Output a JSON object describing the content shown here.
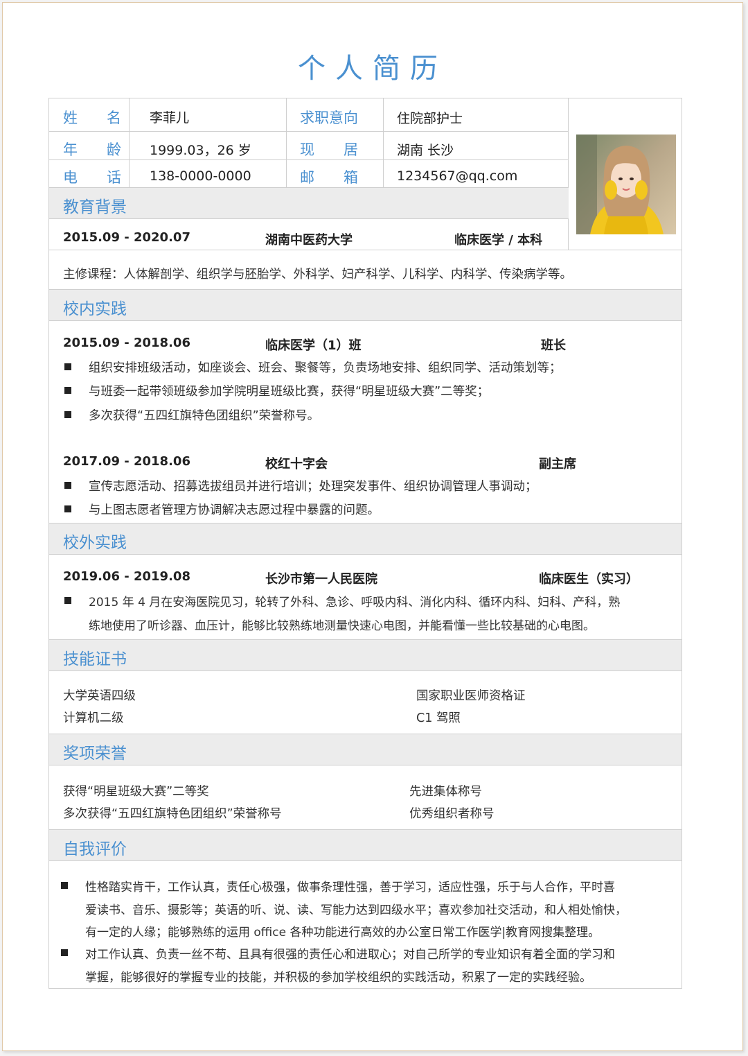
{
  "title": "个人简历",
  "info": {
    "name_label": "姓　　名",
    "name": "李菲儿",
    "intent_label": "求职意向",
    "intent": "住院部护士",
    "age_label": "年　　龄",
    "age": "1999.03，26 岁",
    "residence_label": "现　　居",
    "residence": "湖南 长沙",
    "phone_label": "电　　话",
    "phone": "138-0000-0000",
    "email_label": "邮　　箱",
    "email": "1234567@qq.com"
  },
  "education": {
    "heading": "教育背景",
    "period": "2015.09 - 2020.07",
    "school": "湖南中医药大学",
    "major": "临床医学 / 本科",
    "courses": "主修课程：人体解剖学、组织学与胚胎学、外科学、妇产科学、儿科学、内科学、传染病学等。"
  },
  "campus": {
    "heading": "校内实践",
    "entries": [
      {
        "period": "2015.09 - 2018.06",
        "org": "临床医学（1）班",
        "role": "班长",
        "bullets": [
          "组织安排班级活动，如座谈会、班会、聚餐等，负责场地安排、组织同学、活动策划等；",
          "与班委一起带领班级参加学院明星班级比赛，获得“明星班级大赛”二等奖；",
          "多次获得“五四红旗特色团组织”荣誉称号。"
        ]
      },
      {
        "period": "2017.09 - 2018.06",
        "org": "校红十字会",
        "role": "副主席",
        "bullets": [
          "宣传志愿活动、招募选拔组员并进行培训；处理突发事件、组织协调管理人事调动；",
          "与上图志愿者管理方协调解决志愿过程中暴露的问题。"
        ]
      }
    ]
  },
  "external": {
    "heading": "校外实践",
    "period": "2019.06 - 2019.08",
    "org": "长沙市第一人民医院",
    "role": "临床医生（实习）",
    "line1": "2015 年 4 月在安海医院见习，轮转了外科、急诊、呼吸内科、消化内科、循环内科、妇科、产科，熟",
    "line2": "练地使用了听诊器、血压计，能够比较熟练地测量快速心电图，并能看懂一些比较基础的心电图。"
  },
  "skills": {
    "heading": "技能证书",
    "items": [
      "大学英语四级",
      "国家职业医师资格证",
      "计算机二级",
      "C1 驾照"
    ]
  },
  "awards": {
    "heading": "奖项荣誉",
    "items": [
      "获得“明星班级大赛”二等奖",
      "先进集体称号",
      "多次获得“五四红旗特色团组织”荣誉称号",
      "优秀组织者称号"
    ]
  },
  "self": {
    "heading": "自我评价",
    "p1": [
      "性格踏实肯干，工作认真，责任心极强，做事条理性强，善于学习，适应性强，乐于与人合作，平时喜",
      "爱读书、音乐、摄影等；英语的听、说、读、写能力达到四级水平；喜欢参加社交活动，和人相处愉快，",
      "有一定的人缘；能够熟练的运用 office 各种功能进行高效的办公室日常工作医学|教育网搜集整理。"
    ],
    "p2": [
      "对工作认真、负责一丝不苟、且具有很强的责任心和进取心；对自己所学的专业知识有着全面的学习和",
      "掌握，能够很好的掌握专业的技能，并积极的参加学校组织的实践活动，积累了一定的实践经验。"
    ]
  },
  "colors": {
    "accent": "#4a90d0",
    "section_bg": "#ececec"
  }
}
